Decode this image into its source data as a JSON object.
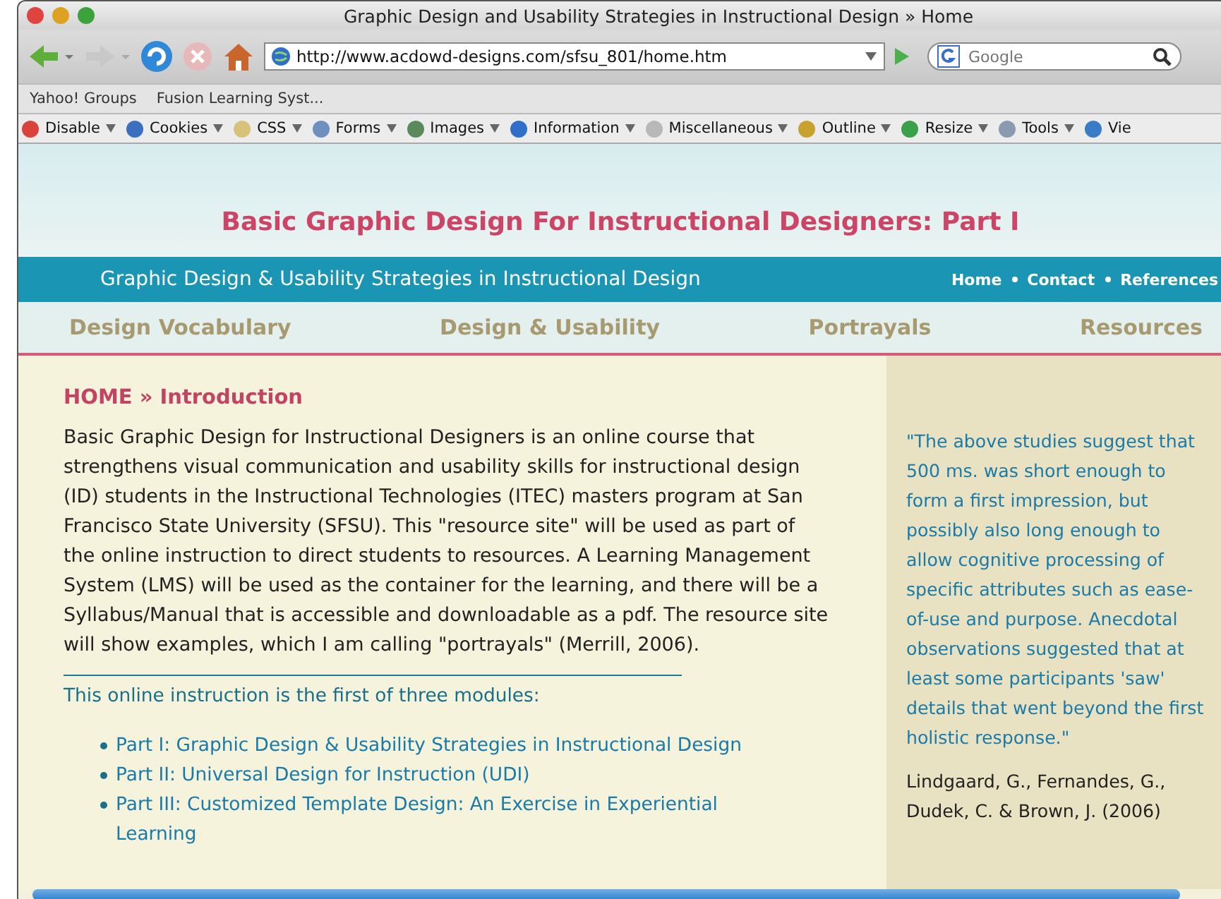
{
  "window": {
    "title": "Graphic Design and Usability Strategies in Instructional Design » Home"
  },
  "address_bar": {
    "url": "http://www.acdowd-designs.com/sfsu_801/home.htm"
  },
  "search": {
    "placeholder": "Google"
  },
  "bookmarks": [
    "Yahoo! Groups",
    "Fusion Learning Syst..."
  ],
  "dev_toolbar": [
    {
      "label": "Disable"
    },
    {
      "label": "Cookies"
    },
    {
      "label": "CSS"
    },
    {
      "label": "Forms"
    },
    {
      "label": "Images"
    },
    {
      "label": "Information"
    },
    {
      "label": "Miscellaneous"
    },
    {
      "label": "Outline"
    },
    {
      "label": "Resize"
    },
    {
      "label": "Tools"
    },
    {
      "label": "Vie"
    }
  ],
  "page": {
    "site_title": "Basic Graphic Design For Instructional Designers: Part I",
    "banner_subtitle": "Graphic Design & Usability Strategies in Instructional Design",
    "top_links": [
      "Home",
      "Contact",
      "References"
    ],
    "nav_tabs": [
      "Design Vocabulary",
      "Design & Usability",
      "Portrayals",
      "Resources"
    ],
    "breadcrumb": "HOME » Introduction",
    "intro": "Basic Graphic Design for Instructional Designers is an online course that strengthens visual communication and usability skills for instructional design (ID) students in the Instructional Technologies (ITEC) masters program at San Francisco State University (SFSU). This \"resource site\" will be used as part of the online instruction to direct students to resources. A Learning Management System (LMS) will be used as the container for the learning, and there will be a Syllabus/Manual that is accessible and downloadable as a pdf. The resource site will show examples, which I am calling \"portrayals\" (Merrill, 2006).",
    "modules_intro": "This online instruction is the first of three modules:",
    "modules": [
      "Part I: Graphic Design & Usability Strategies in Instructional Design",
      "Part II: Universal Design for Instruction (UDI)",
      "Part III: Customized Template Design: An Exercise in Experiential Learning"
    ],
    "quote": "\"The above studies suggest that 500 ms. was short enough to form a first impression, but possibly also long enough to allow cognitive processing of specific attributes such as ease-of-use and purpose. Anecdotal observations suggested that at least some participants 'saw' details that went beyond the first holistic response.\"",
    "citation": "Lindgaard, G., Fernandes, G., Dudek, C. & Brown, J. (2006)"
  }
}
